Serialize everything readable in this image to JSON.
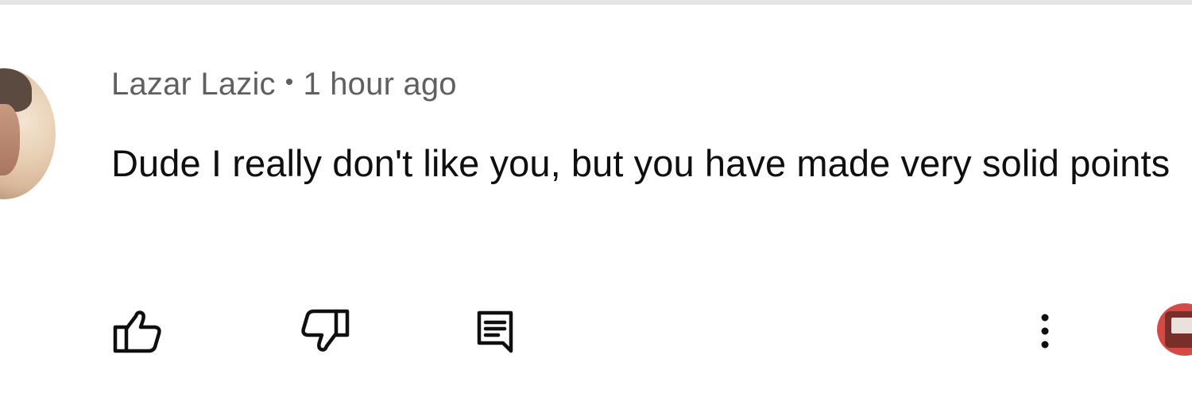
{
  "comment": {
    "author": "Lazar Lazic",
    "separator": "•",
    "timestamp": "1 hour ago",
    "text": "Dude I really don't like you, but you have made very solid points"
  },
  "actions": {
    "like_icon": "thumb-up-icon",
    "dislike_icon": "thumb-down-icon",
    "reply_icon": "reply-icon",
    "more_icon": "more-vert-icon"
  },
  "colors": {
    "meta_text": "#606060",
    "body_text": "#0f0f0f",
    "icon": "#0f0f0f",
    "divider": "#e5e5e5",
    "badge": "#d64a45"
  }
}
